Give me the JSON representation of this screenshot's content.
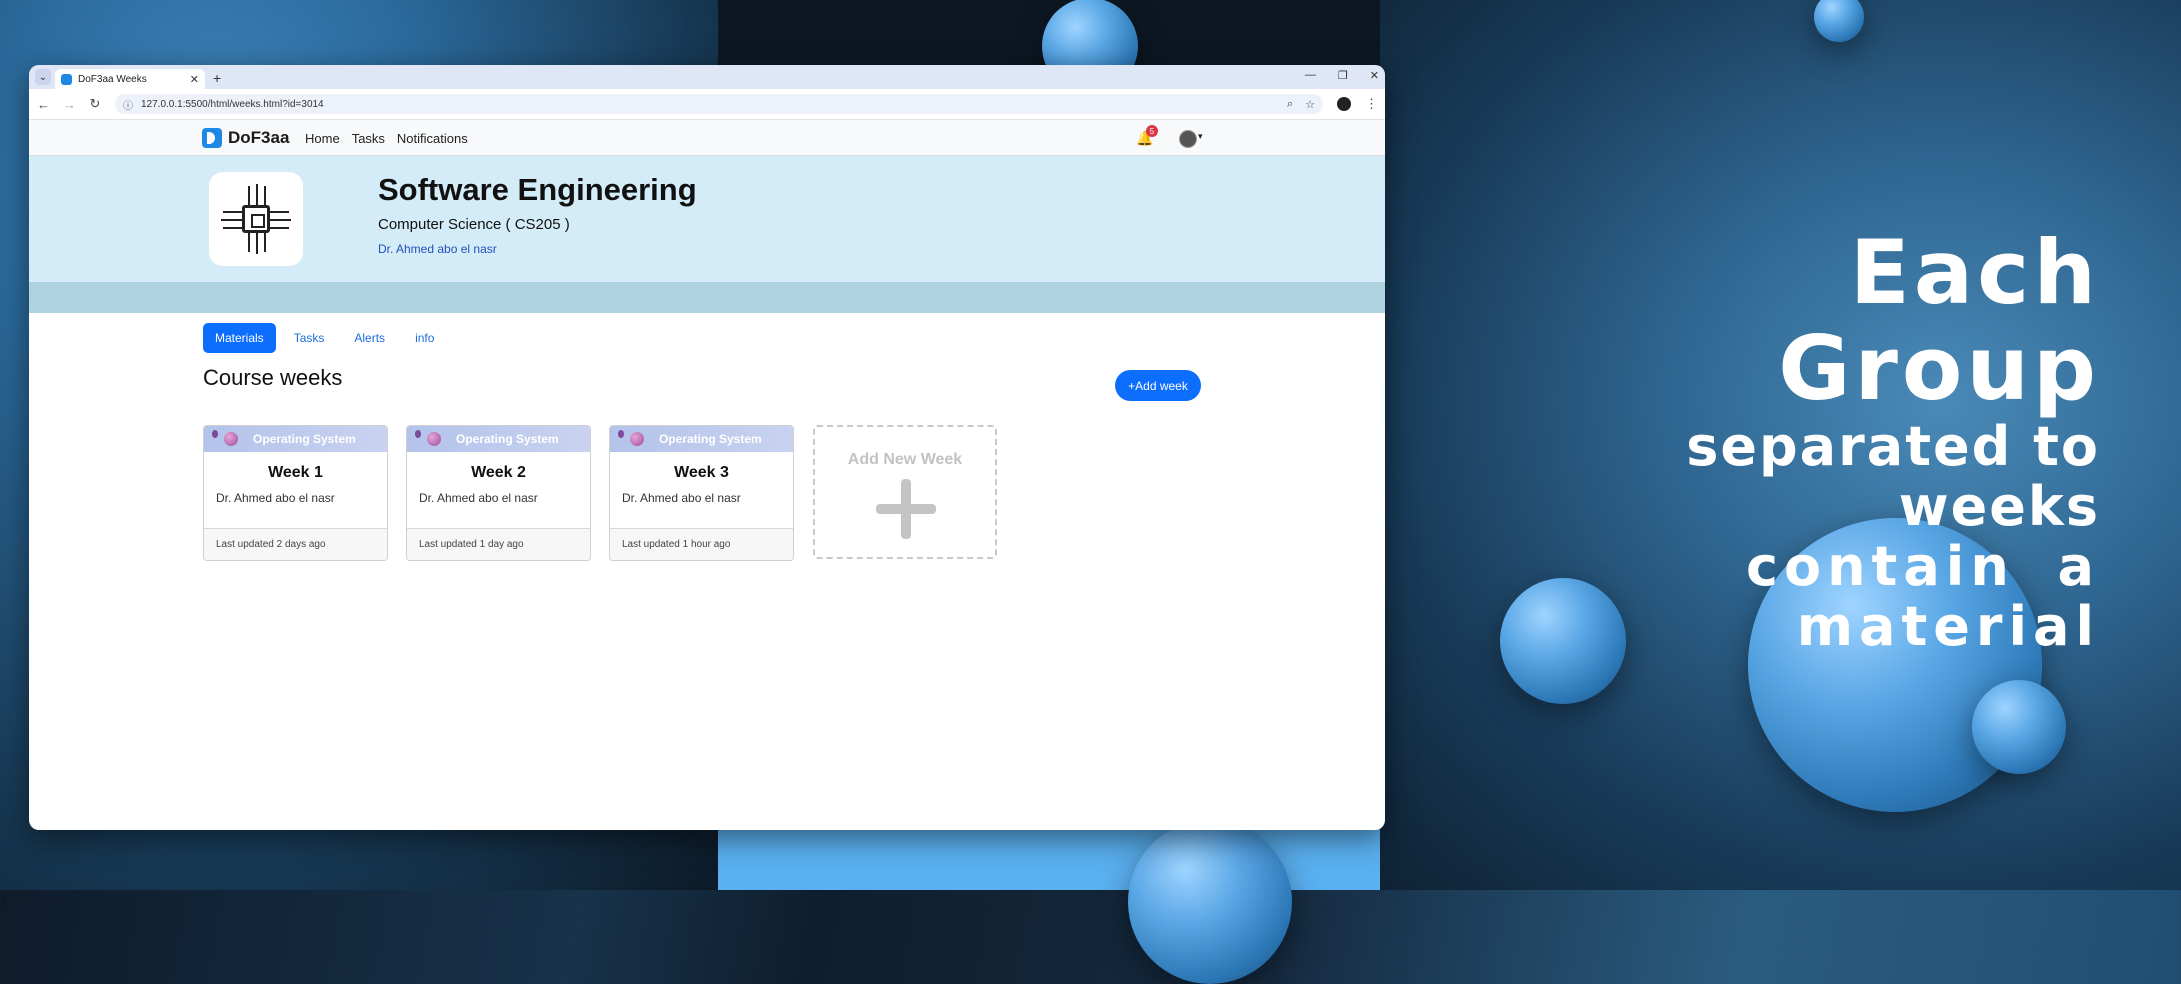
{
  "promo": {
    "line1": "Each Group",
    "line2": "separated to weeks",
    "line3": "contain  a  material"
  },
  "browser": {
    "tab_title": "DoF3aa Weeks",
    "url": "127.0.0.1:5500/html/weeks.html?id=3014"
  },
  "site": {
    "brand": "DoF3aa",
    "nav": [
      "Home",
      "Tasks",
      "Notifications"
    ],
    "notification_count": "5"
  },
  "course": {
    "title": "Software Engineering",
    "subtitle": "Computer Science ( CS205 )",
    "instructor": "Dr. Ahmed abo el nasr"
  },
  "page_tabs": [
    "Materials",
    "Tasks",
    "Alerts",
    "info"
  ],
  "section_title": "Course weeks",
  "add_week_label": "+Add week",
  "weeks": [
    {
      "banner": "Operating System",
      "title": "Week 1",
      "instructor": "Dr. Ahmed abo el nasr",
      "updated": "Last updated 2 days ago"
    },
    {
      "banner": "Operating System",
      "title": "Week 2",
      "instructor": "Dr. Ahmed abo el nasr",
      "updated": "Last updated 1 day ago"
    },
    {
      "banner": "Operating System",
      "title": "Week 3",
      "instructor": "Dr. Ahmed abo el nasr",
      "updated": "Last updated 1 hour ago"
    }
  ],
  "new_week_label": "Add New Week",
  "colors": {
    "primary": "#0d6efd",
    "hero_bg": "#d3ecf8",
    "hero_band": "#aed2df"
  }
}
